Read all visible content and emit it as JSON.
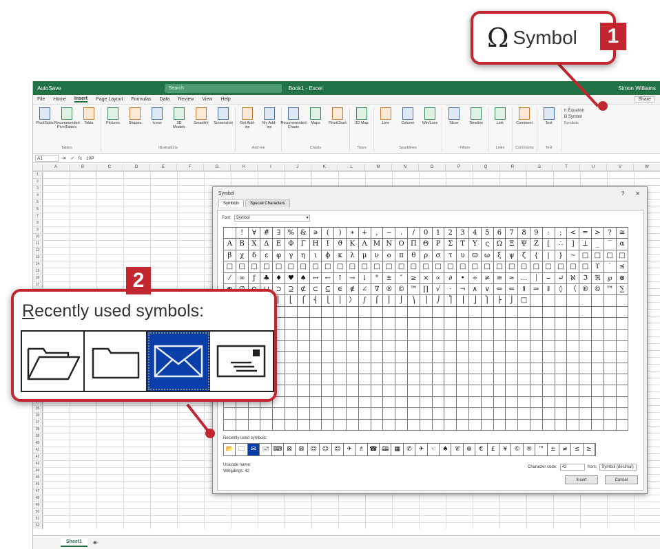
{
  "colors": {
    "accent": "#c2262e",
    "excel_green": "#217346",
    "selection_blue": "#0a3ea8"
  },
  "excel": {
    "title_left": "AutoSave",
    "title_center": "Book1 - Excel",
    "search": "Search",
    "user": "Simon Williams",
    "menu": [
      "File",
      "Home",
      "Insert",
      "Page Layout",
      "Formulas",
      "Data",
      "Review",
      "View",
      "Help"
    ],
    "active_menu": "Insert",
    "share": "Share",
    "ribbon": {
      "tables": {
        "label": "Tables",
        "buttons": [
          "PivotTable",
          "Recommended PivotTables",
          "Table"
        ]
      },
      "illustrations": {
        "label": "Illustrations",
        "buttons": [
          "Pictures",
          "Shapes",
          "Icons",
          "3D Models",
          "SmartArt",
          "Screenshot"
        ]
      },
      "addins": {
        "label": "Add-ins",
        "buttons": [
          "Get Add-ins",
          "My Add-ins"
        ]
      },
      "charts": {
        "label": "Charts",
        "buttons": [
          "Recommended Charts",
          "Maps",
          "PivotChart"
        ]
      },
      "tours": {
        "label": "Tours",
        "buttons": [
          "3D Map"
        ]
      },
      "sparklines": {
        "label": "Sparklines",
        "buttons": [
          "Line",
          "Column",
          "Win/Loss"
        ]
      },
      "filters": {
        "label": "Filters",
        "buttons": [
          "Slicer",
          "Timeline"
        ]
      },
      "links": {
        "label": "Links",
        "buttons": [
          "Link"
        ]
      },
      "comments": {
        "label": "Comments",
        "buttons": [
          "Comment"
        ]
      },
      "text": {
        "label": "Text",
        "buttons": [
          "Text"
        ]
      },
      "symbols": {
        "label": "Symbols",
        "equation": "Equation",
        "symbol": "Symbol"
      }
    },
    "namebox": "A1",
    "formula": "10P",
    "columns": [
      "A",
      "B",
      "C",
      "D",
      "E",
      "F",
      "G",
      "H",
      "I",
      "J",
      "K",
      "L",
      "M",
      "N",
      "O",
      "P",
      "Q",
      "R",
      "S",
      "T",
      "U",
      "V",
      "W"
    ],
    "sheet_tab": "Sheet1"
  },
  "dialog": {
    "title": "Symbol",
    "tabs": [
      "Symbols",
      "Special Characters"
    ],
    "font_label": "Font:",
    "font_value": "Symbol",
    "symbols": [
      " ",
      "!",
      "∀",
      "#",
      "∃",
      "%",
      "&",
      "∍",
      "(",
      ")",
      "∗",
      "+",
      ",",
      "−",
      ".",
      "/",
      "0",
      "1",
      "2",
      "3",
      "4",
      "5",
      "6",
      "7",
      "8",
      "9",
      ":",
      ";",
      "<",
      "=",
      ">",
      "?",
      "≅",
      "Α",
      "Β",
      "Χ",
      "Δ",
      "Ε",
      "Φ",
      "Γ",
      "Η",
      "Ι",
      "ϑ",
      "Κ",
      "Λ",
      "Μ",
      "Ν",
      "Ο",
      "Π",
      "Θ",
      "Ρ",
      "Σ",
      "Τ",
      "Υ",
      "ς",
      "Ω",
      "Ξ",
      "Ψ",
      "Ζ",
      "[",
      "∴",
      "]",
      "⊥",
      "_",
      "‾",
      "α",
      "β",
      "χ",
      "δ",
      "ε",
      "φ",
      "γ",
      "η",
      "ι",
      "ϕ",
      "κ",
      "λ",
      "μ",
      "ν",
      "ο",
      "π",
      "θ",
      "ρ",
      "σ",
      "τ",
      "υ",
      "ϖ",
      "ω",
      "ξ",
      "ψ",
      "ζ",
      "{",
      "|",
      "}",
      "∼",
      "□",
      "□",
      "□",
      "□",
      "□",
      "□",
      "□",
      "□",
      "□",
      "□",
      "□",
      "□",
      "□",
      "□",
      "□",
      "□",
      "□",
      "□",
      "□",
      "□",
      "□",
      "□",
      "□",
      "□",
      "□",
      "□",
      "□",
      "□",
      "□",
      "□",
      "□",
      "□",
      "□",
      "□",
      "ϒ",
      "′",
      "≤",
      "⁄",
      "∞",
      "ƒ",
      "♣",
      "♦",
      "♥",
      "♠",
      "↔",
      "←",
      "↑",
      "→",
      "↓",
      "°",
      "±",
      "″",
      "≥",
      "×",
      "∝",
      "∂",
      "•",
      "÷",
      "≠",
      "≡",
      "≈",
      "…",
      "⏐",
      "⎯",
      "↵",
      "ℵ",
      "ℑ",
      "ℜ",
      "℘",
      "⊗",
      "⊕",
      "∅",
      "∩",
      "∪",
      "⊃",
      "⊇",
      "⊄",
      "⊂",
      "⊆",
      "∈",
      "∉",
      "∠",
      "∇",
      "®",
      "©",
      "™",
      "∏",
      "√",
      "⋅",
      "¬",
      "∧",
      "∨",
      "⇔",
      "⇐",
      "⇑",
      "⇒",
      "⇓",
      "◊",
      "〈",
      "®",
      "©",
      "™",
      "∑",
      "⎛",
      "⎜",
      "⎝",
      "⎡",
      "⎢",
      "⎣",
      "⎧",
      "⎨",
      "⎩",
      "⎪",
      "〉",
      "∫",
      "⌠",
      "⎮",
      "⌡",
      "⎞",
      "⎟",
      "⎠",
      "⎤",
      "⎥",
      "⎦",
      "⎫",
      "⎬",
      "⎭",
      "□",
      "",
      "",
      "",
      "",
      "",
      "",
      "",
      ""
    ],
    "recent_label": "Recently used symbols:",
    "recent": [
      "📂",
      "🗀",
      "✉",
      "🖃",
      "⌨",
      "⊠",
      "⊠",
      "☺",
      "☺",
      "☺",
      "✈",
      "♗",
      "☎",
      "🕮",
      "▦",
      "✆",
      "✈",
      "☜",
      "♠",
      "𝒞",
      "⊕",
      "€",
      "£",
      "¥",
      "©",
      "®",
      "™",
      "±",
      "≠",
      "≤",
      "≥"
    ],
    "unicode_name_label": "Unicode name:",
    "unicode_name_value": "Wingdings: 42",
    "char_code_label": "Character code:",
    "char_code_value": "42",
    "from_label": "from:",
    "from_value": "Symbol (decimal)",
    "insert": "Insert",
    "cancel": "Cancel"
  },
  "callout1": {
    "label": "Symbol",
    "badge": "1"
  },
  "callout2": {
    "title_first": "R",
    "title_rest": "ecently used symbols:",
    "badge": "2",
    "icons": [
      "open-folder-icon",
      "folder-icon",
      "envelope-icon",
      "postcard-icon"
    ]
  }
}
